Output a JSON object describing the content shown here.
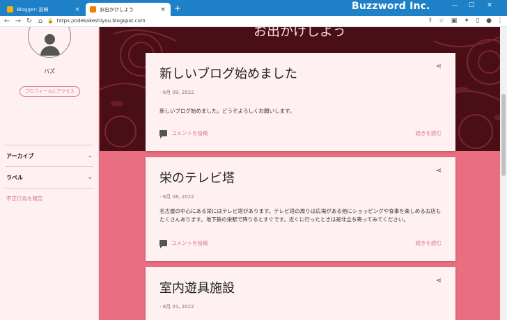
{
  "browser": {
    "tabs": [
      {
        "title": "Blogger: 投稿",
        "close": "×"
      },
      {
        "title": "お出かけしよう",
        "close": "×"
      }
    ],
    "new_tab": "+",
    "watermark": "Buzzword Inc.",
    "window_controls": {
      "minimize": "—",
      "maximize": "☐",
      "close": "✕"
    },
    "nav": {
      "back": "←",
      "forward": "→",
      "reload": "↻",
      "home": "⌂"
    },
    "url": "https://odekakeshiyou.blogspot.com",
    "toolbar_icons": [
      "share-icon",
      "star-icon",
      "extension-icon",
      "puzzle-icon",
      "sidepanel-icon",
      "profile-icon",
      "menu-icon"
    ]
  },
  "sidebar": {
    "username": "バズ",
    "profile_button": "プロフィールにアクセス",
    "sections": [
      {
        "label": "アーカイブ",
        "chevron": "⌄"
      },
      {
        "label": "ラベル",
        "chevron": "⌄"
      }
    ],
    "report": "不正行為を報告"
  },
  "blog": {
    "title": "お出かけしよう"
  },
  "posts": [
    {
      "title": "新しいブログ始めました",
      "date": "- 6月 09, 2022",
      "body": "新しいブログ始めました。どうぞよろしくお願いします。",
      "comment": "コメントを投稿",
      "more": "続きを読む"
    },
    {
      "title": "栄のテレビ塔",
      "date": "- 6月 08, 2022",
      "body": "名古屋の中心にある栄にはテレビ塔があります。テレビ塔の周りは広場がある他にショッピングや食事を楽しめるお店もたくさんあります。地下鉄の栄駅で降りるとすぐです。近くに行ったときは是非立ち寄ってみてください。",
      "comment": "コメントを投稿",
      "more": "続きを読む"
    },
    {
      "title": "室内遊具施設",
      "date": "- 6月 01, 2022"
    }
  ],
  "colors": {
    "accent": "#d6778a",
    "page_background": "#e86e80",
    "card_background": "#fff0f1",
    "header_background": "#4a0f16",
    "chrome": "#1e80c6"
  }
}
